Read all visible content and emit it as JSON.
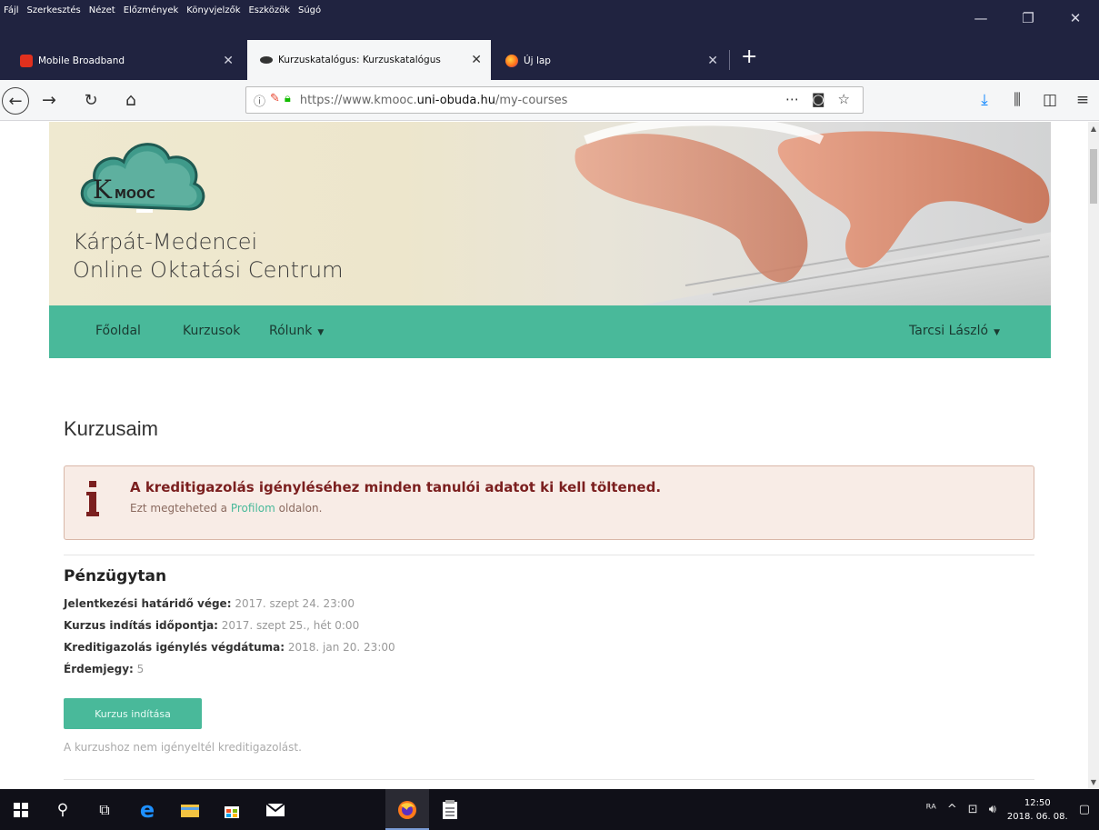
{
  "menu": [
    "Fájl",
    "Szerkesztés",
    "Nézet",
    "Előzmények",
    "Könyvjelzők",
    "Eszközök",
    "Súgó"
  ],
  "window_controls": [
    "minimize",
    "restore",
    "close"
  ],
  "tabs": [
    {
      "label": "Mobile Broadband",
      "icon": "huawei-icon"
    },
    {
      "label": "Kurzuskatalógus: Kurzuskatalógus",
      "icon": "kmooc-icon"
    },
    {
      "label": "Új lap",
      "icon": "firefox-icon"
    }
  ],
  "url": {
    "prefix": "https://www.kmooc.",
    "domain": "uni-obuda.hu",
    "path": "/my-courses"
  },
  "site": {
    "line1": "Kárpát-Medencei",
    "line2": "Online Oktatási Centrum",
    "logo_text": "K MOOC"
  },
  "nav": {
    "home": "Főoldal",
    "courses": "Kurzusok",
    "about": "Rólunk",
    "user": "Tarcsi László"
  },
  "page_title": "Kurzusaim",
  "alert": {
    "title": "A kreditigazolás igényléséhez minden tanulói adatot ki kell töltened.",
    "sub_before": "Ezt megteheted a ",
    "sub_link": "Profilom",
    "sub_after": " oldalon."
  },
  "course": {
    "title": "Pénzügytan",
    "rows": [
      {
        "label": "Jelentkezési határidő vége:",
        "value": " 2017. szept 24. 23:00"
      },
      {
        "label": "Kurzus indítás időpontja:",
        "value": " 2017. szept 25., hét 0:00"
      },
      {
        "label": "Kreditigazolás igénylés végdátuma:",
        "value": "  2018. jan 20. 23:00"
      },
      {
        "label": "Érdemjegy:",
        "value": " 5"
      }
    ],
    "button": "Kurzus indítása",
    "note": "A kurzushoz nem igényeltél kreditigazolást."
  },
  "taskbar": {
    "time": "12:50",
    "date": "2018. 06. 08."
  },
  "colors": {
    "accent": "#49b99a",
    "titlebar": "#202340",
    "alert_bg": "#f8ece6"
  }
}
